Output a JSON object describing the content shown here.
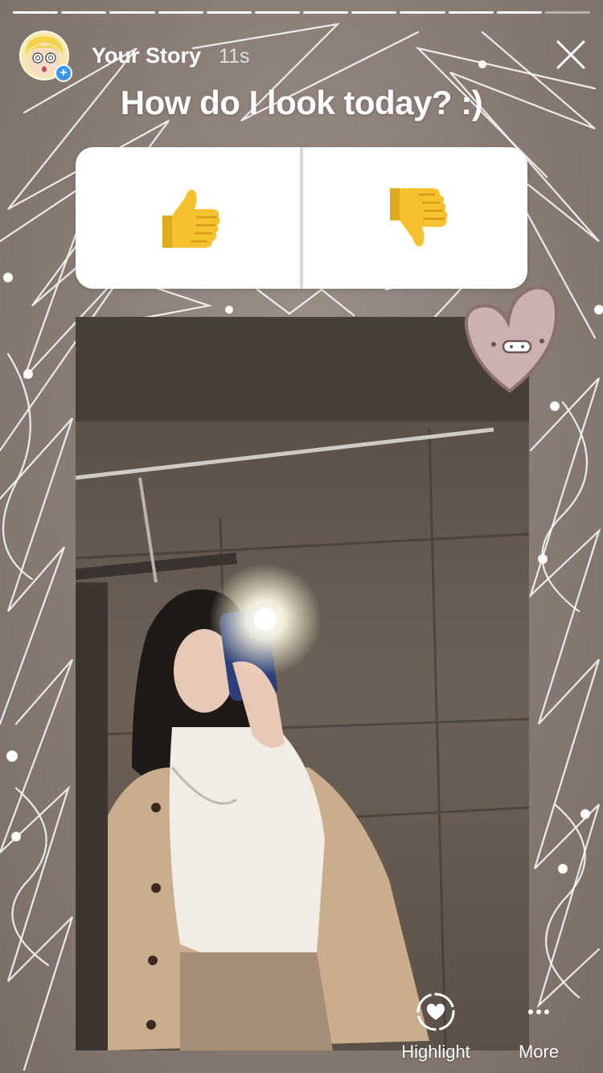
{
  "story": {
    "name": "Your Story",
    "time": "11s",
    "progress_segments": 12,
    "active_segment": 11
  },
  "sticker": {
    "question": "How do I look today? :)",
    "options": [
      {
        "icon": "thumbs-up-icon",
        "glyph": "👍"
      },
      {
        "icon": "thumbs-down-icon",
        "glyph": "👎"
      }
    ]
  },
  "actions": {
    "highlight_label": "Highlight",
    "more_label": "More"
  },
  "colors": {
    "accent": "#3897f0",
    "heart": "#c7aeae"
  }
}
